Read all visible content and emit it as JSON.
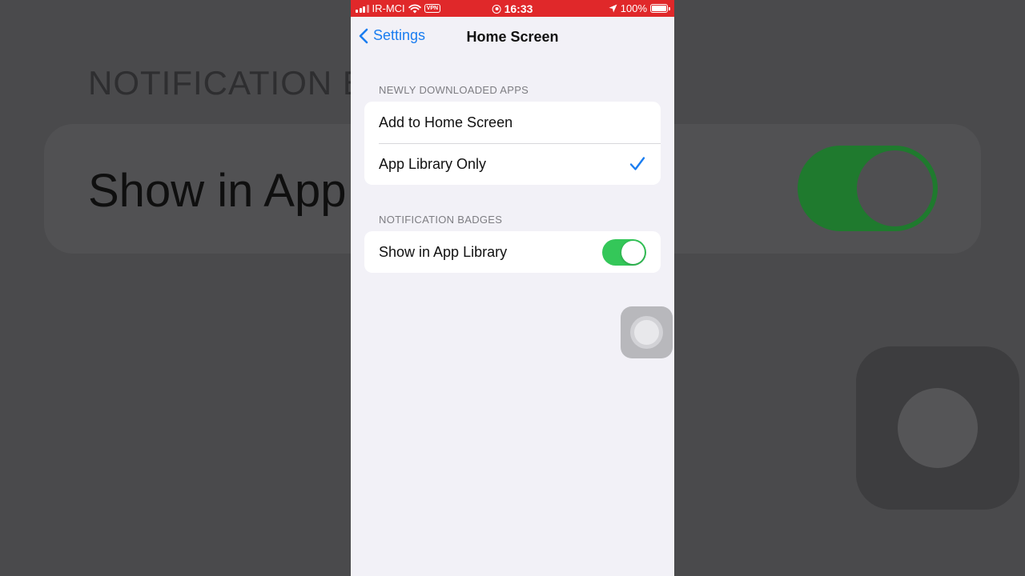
{
  "status_bar": {
    "carrier": "IR-MCI",
    "vpn": "VPN",
    "time": "16:33",
    "battery": "100%"
  },
  "nav": {
    "back_label": "Settings",
    "title": "Home Screen"
  },
  "sections": [
    {
      "header": "NEWLY DOWNLOADED APPS",
      "rows": [
        {
          "label": "Add to Home Screen",
          "selected": false
        },
        {
          "label": "App Library Only",
          "selected": true
        }
      ]
    },
    {
      "header": "NOTIFICATION BADGES",
      "rows": [
        {
          "label": "Show in App Library",
          "toggle": true
        }
      ]
    }
  ],
  "background": {
    "header_fragment": "NOTIFICATION B",
    "row_fragment": "Show in App"
  },
  "colors": {
    "status_bar": "#e0282a",
    "accent": "#1a7df0",
    "toggle_on": "#34c759",
    "background": "#f2f1f7"
  }
}
